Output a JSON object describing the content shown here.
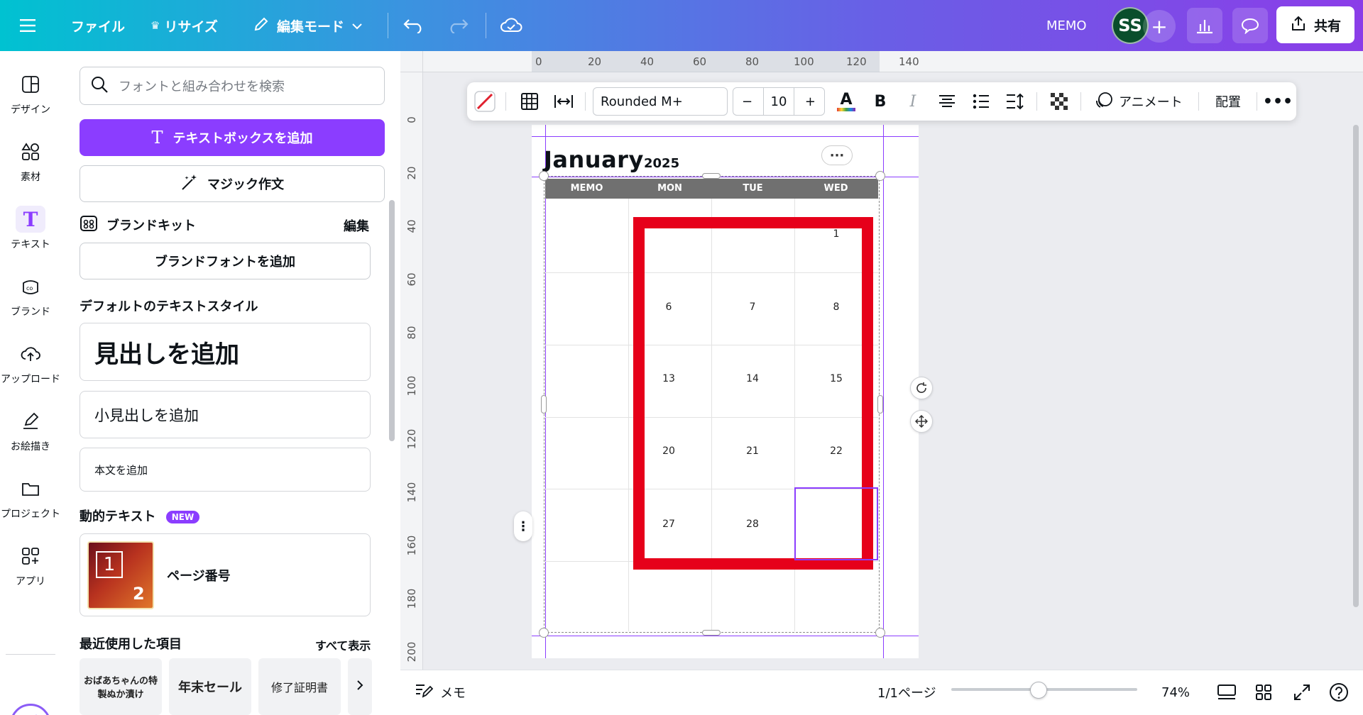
{
  "topbar": {
    "file_label": "ファイル",
    "resize_label": "リサイズ",
    "edit_mode_label": "編集モード",
    "project_name": "MEMO",
    "avatar_initials": "SS",
    "share_label": "共有"
  },
  "rail": {
    "items": [
      {
        "label": "デザイン",
        "icon": "layout-icon"
      },
      {
        "label": "素材",
        "icon": "shapes-icon"
      },
      {
        "label": "テキスト",
        "icon": "text-icon"
      },
      {
        "label": "ブランド",
        "icon": "brand-icon"
      },
      {
        "label": "アップロード",
        "icon": "cloud-upload-icon"
      },
      {
        "label": "お絵描き",
        "icon": "pen-icon"
      },
      {
        "label": "プロジェクト",
        "icon": "folder-icon"
      },
      {
        "label": "アプリ",
        "icon": "apps-icon"
      }
    ],
    "active": "テキスト"
  },
  "panel": {
    "search_placeholder": "フォントと組み合わせを検索",
    "add_textbox": "テキストボックスを追加",
    "magic_write": "マジック作文",
    "brand_kit_title": "ブランドキット",
    "brand_kit_edit": "編集",
    "add_brand_font": "ブランドフォントを追加",
    "default_styles_title": "デフォルトのテキストスタイル",
    "add_heading": "見出しを追加",
    "add_subheading": "小見出しを追加",
    "add_body": "本文を追加",
    "dynamic_text_title": "動的テキスト",
    "new_badge": "NEW",
    "page_number_label": "ページ番号",
    "page_number_digit_1": "1",
    "page_number_digit_2": "2",
    "recent_title": "最近使用した項目",
    "recent_show_all": "すべて表示",
    "recent_thumbs": [
      "おばあちゃんの特製ぬか漬け",
      "年末セール",
      "修了証明書"
    ]
  },
  "toolbar": {
    "font_name": "Rounded M+",
    "font_size": "10",
    "animate_label": "アニメート",
    "position_label": "配置"
  },
  "rulers": {
    "top": [
      "0",
      "20",
      "40",
      "60",
      "80",
      "100",
      "120",
      "140"
    ],
    "left": [
      "0",
      "20",
      "40",
      "60",
      "80",
      "100",
      "120",
      "140",
      "160",
      "180",
      "200"
    ]
  },
  "calendar": {
    "month": "January",
    "year": "2025",
    "headers": [
      "MEMO",
      "MON",
      "TUE",
      "WED"
    ],
    "rows": [
      [
        "",
        "",
        "",
        "1"
      ],
      [
        "",
        "6",
        "7",
        "8"
      ],
      [
        "",
        "13",
        "14",
        "15"
      ],
      [
        "",
        "20",
        "21",
        "22"
      ],
      [
        "",
        "27",
        "28",
        ""
      ],
      [
        "",
        "",
        "",
        ""
      ]
    ]
  },
  "bottombar": {
    "notes_label": "メモ",
    "page_indicator": "1/1ページ",
    "zoom_value": "74%",
    "zoom_fraction": 0.47
  },
  "colors": {
    "accent": "#8b3dff",
    "highlight_frame": "#e6001a",
    "header_gray": "#707070"
  }
}
